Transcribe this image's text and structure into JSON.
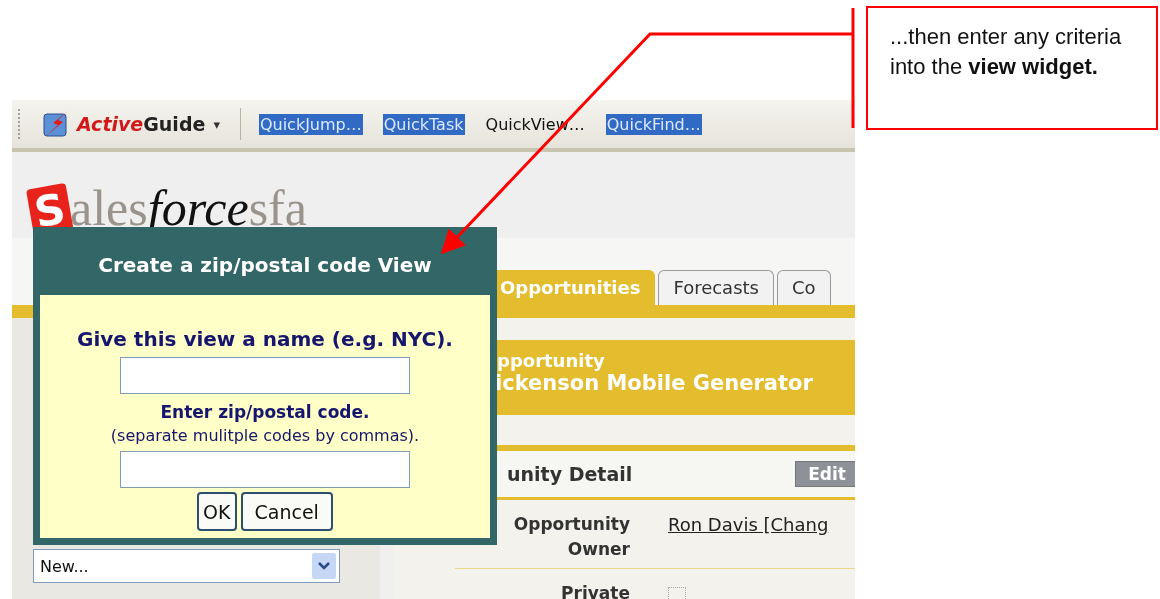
{
  "toolbar": {
    "brand": {
      "part_1": "Active",
      "part_2": "Guide",
      "caret": "▾"
    },
    "links": [
      {
        "label": "QuickJump…",
        "highlighted": true
      },
      {
        "label": "QuickTask",
        "highlighted": true
      },
      {
        "label": "QuickView…",
        "highlighted": false
      },
      {
        "label": "QuickFind…",
        "highlighted": true
      }
    ]
  },
  "logo": {
    "mark": "S",
    "part_1": "ales",
    "part_2": "force",
    "part_3": "sfa"
  },
  "tabs": [
    {
      "label": "Opportunities",
      "selected": true
    },
    {
      "label": "Forecasts",
      "selected": false
    },
    {
      "label": "Co",
      "selected": false
    }
  ],
  "record": {
    "type": "pportunity",
    "name": "ickenson Mobile Generator"
  },
  "detail": {
    "title": "unity Detail",
    "edit_button": "Edit",
    "fields": [
      {
        "label": "Opportunity Owner",
        "kind": "link",
        "value": "Ron Davis [Chang"
      },
      {
        "label": "Private",
        "kind": "checkbox",
        "checked": false
      }
    ]
  },
  "sidebar": {
    "select_value": "New..."
  },
  "dialog": {
    "title": "Create a zip/postal code View",
    "name_prompt": "Give this view a name (e.g. NYC).",
    "code_prompt": "Enter zip/postal code.",
    "code_hint": "(separate mulitple codes by commas).",
    "buttons": [
      "OK",
      "Cancel"
    ]
  },
  "callout": {
    "text": "...then enter any criteria into the **view widget.**"
  }
}
